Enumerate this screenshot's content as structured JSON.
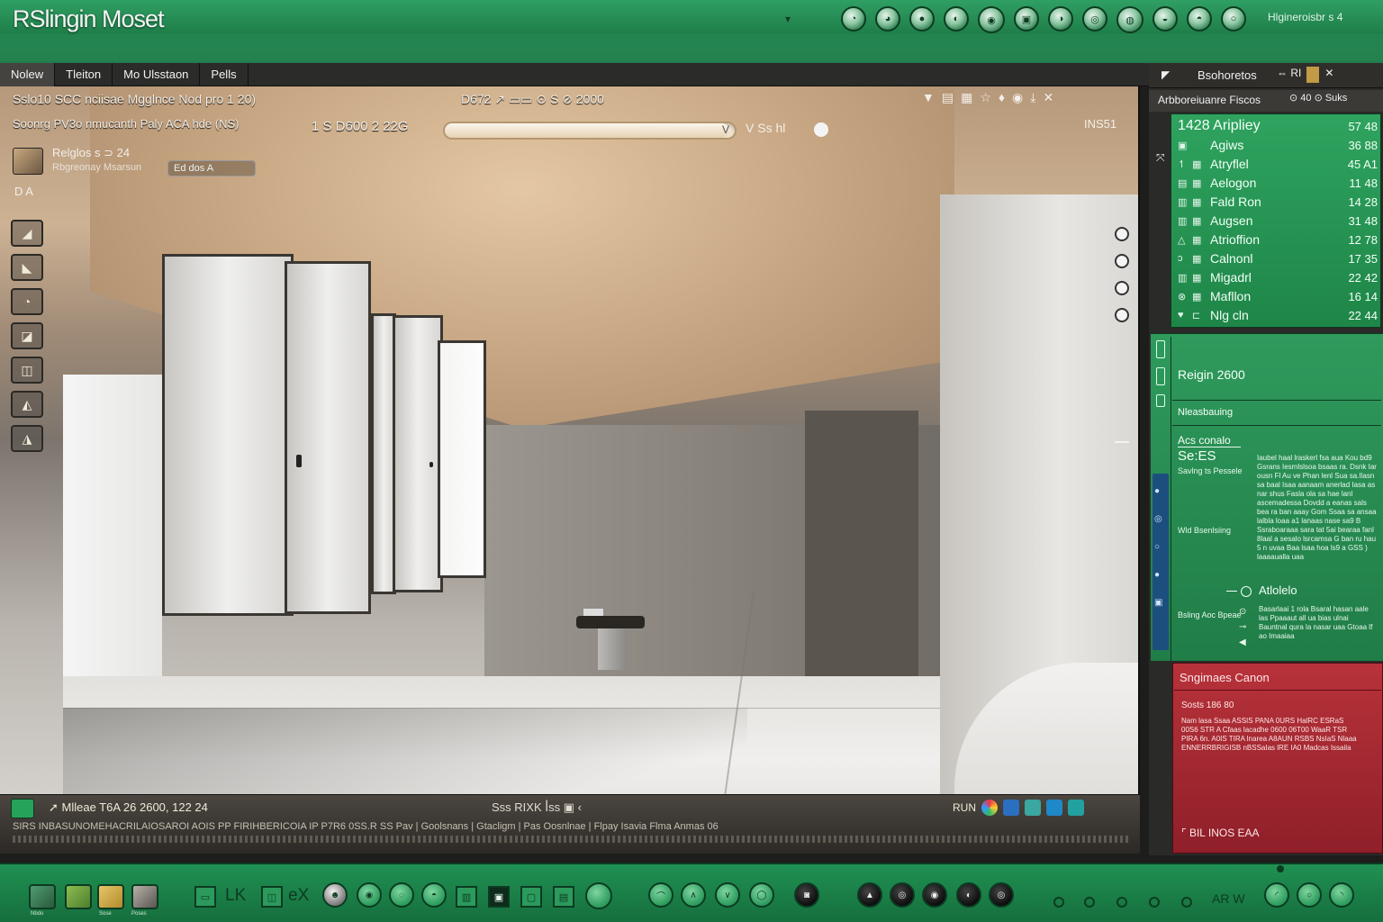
{
  "window": {
    "title": "RSlingin Moset",
    "status": "Hlgineroisbr s 4"
  },
  "tabs": [
    {
      "label": "Nolew"
    },
    {
      "label": "Tleiton"
    },
    {
      "label": "Mo Ulsstaon"
    },
    {
      "label": "Pells"
    }
  ],
  "viewport": {
    "info_line1": "Sslo10  SCC nciisae  Mgglnce Nod pro 1 20)",
    "info_line2": "Soonrg PV3o  nmucanth Paly ACA hde  (NS)",
    "center_top": "D672 ↗ ▭▭ ⊙ S ⊘  2000",
    "center_mid": "1 S  D600 2 22G",
    "progress_fraction": 0.98,
    "progress_label": "V",
    "right_label": "V  Ss  hl",
    "corner_label": "INS51",
    "tools": [
      "▼",
      "▤",
      "▦",
      "☆",
      "♦",
      "◉",
      "⤓",
      "✕"
    ],
    "layer": {
      "name": "Relglos  s  ⊃ 24",
      "sub": "Rbgreonay  Msarsun",
      "chip": "Ed  dos   A"
    },
    "small_icons": "D A",
    "side_tools": [
      "◢",
      "◣",
      "◔",
      "◪",
      "◫",
      "◭",
      "◮"
    ],
    "bottom": {
      "info": "➚  Mlleae  T6A  26  2600,  122  24",
      "mid": "Sss RIXK ꟾss   ▣   ‹",
      "right_label": "RUN",
      "status_line": "SIRS INBASUNOMEHACRILAIOSAROI AOIS  PP FIRIHBERICOIA  IP P7R6   0SS.R   SS Pav  |  Goolsnans  |  Gtacligm   |   Pas Oosnlnae  |   Flpay Isavia Flma  Anmas          06"
    }
  },
  "right_panel": {
    "header_title": "Bsohoretos",
    "header_icons": "⇔ RI",
    "sub_title": "Arbboreiuanre  Fiscos",
    "sub_right": "⊙ 40  ⊙ Suks",
    "items": [
      {
        "label": "1428 Aripliey",
        "value": "57 48"
      },
      {
        "label": "Agiws",
        "value": "36 88"
      },
      {
        "label": "Atryflel",
        "value": "45 A1"
      },
      {
        "label": "Aelogon",
        "value": "11 48"
      },
      {
        "label": "Fald Ron",
        "value": "14 28"
      },
      {
        "label": "Augsen",
        "value": "31 48"
      },
      {
        "label": "Atrioffion",
        "value": "12 78"
      },
      {
        "label": "Calnonl",
        "value": "17 35"
      },
      {
        "label": "Migadrl",
        "value": "22 42"
      },
      {
        "label": "Mafllon",
        "value": "16 14"
      },
      {
        "label": "Nlg cln",
        "value": "22 44"
      }
    ],
    "region_title": "Reigin 2600",
    "measure_label": "Nleasbauing",
    "acc_label": "Acs conalo",
    "sizes_label": "Se:ES",
    "sizes_sub": "Savlng  ts  Pessele",
    "props_text": "Iaubel haal lraskerl fsa aua Kou bd9 Gsrans Iesmlslsoa bsaas ra. Dsnk Iar ousn Fl  Au ve Phan  lenl Sua sa.Ilasn sa baal Isaa aanaam  anerlad Iasa  as nar shus Fasla ola sa hae  lanl ascemadessa Dovdd a eanas sals bea ra ban aaay Gom  Ssaa sa ansaa lalbla loaa a1 lanaas nase sa9 B  Ssraboaraaa sara tat 5ai bearaa  fanl  8laal a sesalo lsrcamsa G ban ru hau 5 n uvaa  Baa lsaa hoa ls9 a GSS ) laaaaualla uaa",
    "wia_label": "Wld Bsenlsiing",
    "atlas_label": "Atlolelo",
    "bspec_label": "Bsling Aoc Bpeae",
    "bspec_text": "Basarlaai 1 rola Bsaral hasan aale las Ppaaaut  all ua bias ulnai Bauntnal qura la nasar uaa Gtoaa  lf ao Imaaiaa",
    "red": {
      "title": "Sngimaes  Canon",
      "sub": "Sosts 186  80",
      "text": "Nam  lasa  Ssaa ASSIS  PANA  0URS HalRC ESRaS 00S6 STR A Cfaas lacadhe 0600 06T00 WaaR TSR PIRA  6n. A0IS TIRA  lnarea A8AUN RSBS NsIaS Nlaaa ENNERRBRIGISB nBSSaIas  lRE  IA0 Madcas  Issaila",
      "foot": "⌜  BIL  INOS EAA"
    }
  },
  "dock": {
    "thumb_labels": [
      "Nbdo",
      "Sose",
      "Poses"
    ],
    "text1": "LK",
    "text2": "eX",
    "label": "AR W"
  },
  "colors": {
    "accent_green": "#1f7e49",
    "red_panel": "#b8323a",
    "blue_strip": "#1c4f7d"
  }
}
